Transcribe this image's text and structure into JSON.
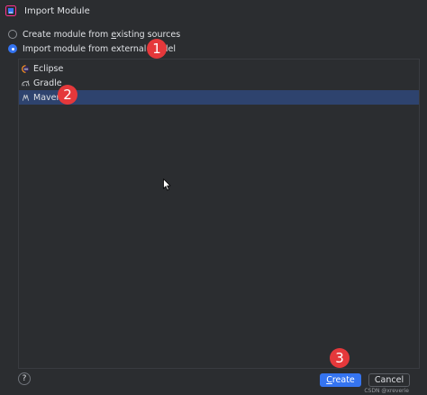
{
  "window": {
    "title": "Import Module"
  },
  "options": [
    {
      "label_prefix": "Create module from ",
      "label_underlined": "e",
      "label_suffix": "xisting sources",
      "checked": false
    },
    {
      "label_prefix": "Import module from external ",
      "label_underlined": "m",
      "label_suffix": "odel",
      "checked": true
    }
  ],
  "models": [
    {
      "label": "Eclipse",
      "icon": "eclipse-icon",
      "selected": false
    },
    {
      "label": "Gradle",
      "icon": "gradle-icon",
      "selected": false
    },
    {
      "label": "Maven",
      "icon": "maven-icon",
      "selected": true
    }
  ],
  "annotations": [
    "1",
    "2",
    "3"
  ],
  "footer": {
    "help": "?",
    "create_prefix": "C",
    "create_rest": "reate",
    "cancel": "Cancel"
  },
  "watermark": "CSDN @xreverie",
  "colors": {
    "background": "#2b2d30",
    "accent": "#3574f0",
    "selection": "#2e436e",
    "badge": "#e5383b"
  }
}
